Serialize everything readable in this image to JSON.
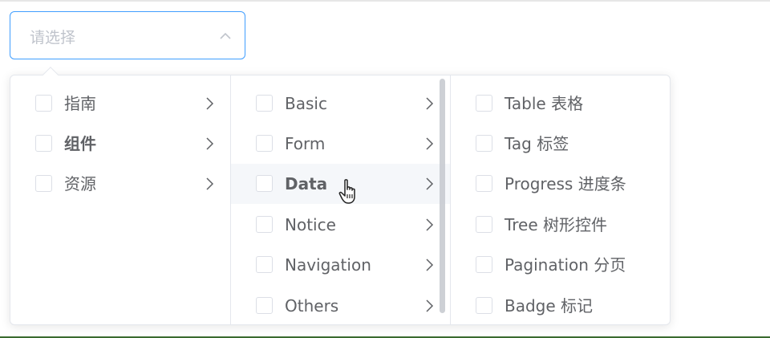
{
  "select": {
    "placeholder": "请选择"
  },
  "menus": {
    "level1": [
      {
        "label": "指南",
        "bold": false
      },
      {
        "label": "组件",
        "bold": true
      },
      {
        "label": "资源",
        "bold": false
      }
    ],
    "level2": [
      {
        "label": "Basic",
        "bold": false
      },
      {
        "label": "Form",
        "bold": false
      },
      {
        "label": "Data",
        "bold": true,
        "hover": true
      },
      {
        "label": "Notice",
        "bold": false
      },
      {
        "label": "Navigation",
        "bold": false
      },
      {
        "label": "Others",
        "bold": false
      }
    ],
    "level3": [
      {
        "label": "Table 表格"
      },
      {
        "label": "Tag 标签"
      },
      {
        "label": "Progress 进度条"
      },
      {
        "label": "Tree 树形控件"
      },
      {
        "label": "Pagination 分页"
      },
      {
        "label": "Badge 标记"
      }
    ]
  },
  "icons": {
    "select_arrow": "chevron-up-icon",
    "submenu_arrow": "chevron-right-icon",
    "pointer": "hand-pointer-icon"
  },
  "colors": {
    "accent": "#409eff",
    "text": "#606266",
    "placeholder": "#c0c4cc",
    "border": "#e4e7ed",
    "hover_bg": "#f5f7fa"
  }
}
